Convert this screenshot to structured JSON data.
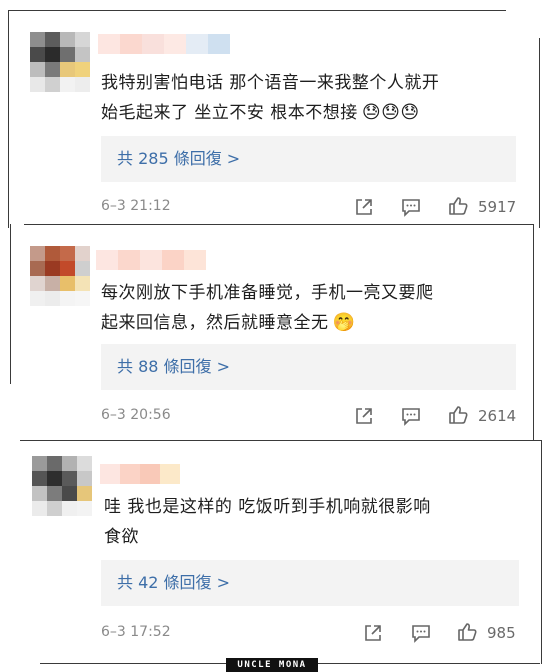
{
  "comments": [
    {
      "text": "我特别害怕电话 那个语音一来我整个人就开始毛起来了 坐立不安 根本不想接",
      "line1": "我特别害怕电话 那个语音一来我整个人就开",
      "line2": "始毛起来了 坐立不安 根本不想接",
      "emoji": "😓😓😓",
      "replies": "共 285 條回復 >",
      "time": "6–3 21:12",
      "likes": "5917"
    },
    {
      "text": "每次刚放下手机准备睡觉，手机一亮又要爬起来回信息，然后就睡意全无",
      "line1": "每次刚放下手机准备睡觉，手机一亮又要爬",
      "line2": "起来回信息，然后就睡意全无",
      "emoji": "🤭",
      "replies": "共 88 條回復 >",
      "time": "6–3 20:56",
      "likes": "2614"
    },
    {
      "text": "哇 我也是这样的 吃饭听到手机响就很影响食欲",
      "line1": "哇 我也是这样的 吃饭听到手机响就很影响",
      "line2": "食欲",
      "emoji": "",
      "replies": "共 42 條回復 >",
      "time": "6–3 17:52",
      "likes": "985"
    }
  ],
  "icons": [
    "share-icon",
    "comment-icon",
    "like-icon"
  ],
  "watermark": "UNCLE MONA",
  "colors": {
    "link": "#3d6ea8",
    "meta": "#8a8a8a",
    "reply_bg": "#f3f3f3"
  }
}
